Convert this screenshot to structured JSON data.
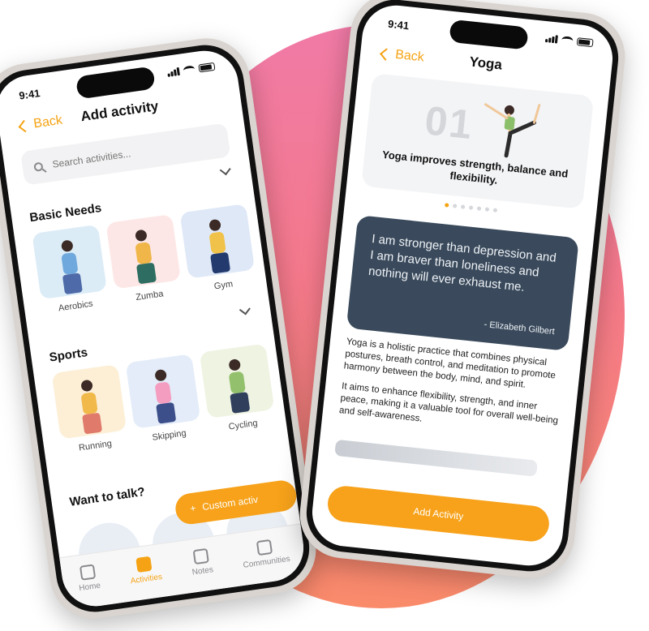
{
  "left_phone": {
    "time": "9:41",
    "back_label": "Back",
    "title": "Add activity",
    "search_placeholder": "Search activities...",
    "sections": [
      {
        "title": "Basic Needs",
        "items": [
          {
            "label": "Aerobics",
            "bg": "#dcecf7",
            "top": "#6fa8dc",
            "bottom": "#4f6aa8"
          },
          {
            "label": "Zumba",
            "bg": "#fde7e6",
            "top": "#f0b64a",
            "bottom": "#2e6e62"
          },
          {
            "label": "Gym",
            "bg": "#dfe8f7",
            "top": "#f0c24a",
            "bottom": "#223a6d"
          }
        ]
      },
      {
        "title": "Sports",
        "items": [
          {
            "label": "Running",
            "bg": "#fcefd6",
            "top": "#f0b94a",
            "bottom": "#e07a6b"
          },
          {
            "label": "Skipping",
            "bg": "#e3ecf8",
            "top": "#f59dc0",
            "bottom": "#3d4f8a"
          },
          {
            "label": "Cycling",
            "bg": "#eef3e2",
            "top": "#92c06c",
            "bottom": "#2f3f5c"
          }
        ]
      }
    ],
    "talk_title": "Want to talk?",
    "fab_label": "Custom activ",
    "fab_plus": "+",
    "tabs": [
      {
        "label": "Home",
        "active": false
      },
      {
        "label": "Activities",
        "active": true
      },
      {
        "label": "Notes",
        "active": false
      },
      {
        "label": "Communities",
        "active": false
      }
    ]
  },
  "right_phone": {
    "time": "9:41",
    "back_label": "Back",
    "title": "Yoga",
    "hero_number": "01",
    "hero_caption": "Yoga improves strength, balance and flexibility.",
    "quote_text": "I am stronger than depression and I am braver than loneliness and nothing will ever exhaust me.",
    "quote_author": "- Elizabeth Gilbert",
    "description": [
      "Yoga is a holistic practice that combines physical postures, breath control, and meditation to promote harmony between the body, mind, and spirit.",
      "It aims to enhance flexibility, strength, and inner peace, making it a valuable tool for overall well-being and self-awareness."
    ],
    "cta_label": "Add Activity"
  },
  "colors": {
    "accent": "#f5a314",
    "quote_bg": "#3a4a5c"
  }
}
